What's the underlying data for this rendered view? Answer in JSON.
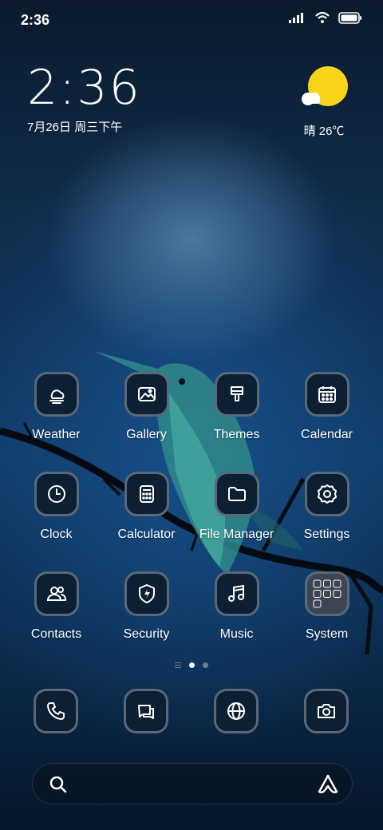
{
  "status_bar": {
    "time": "2:36"
  },
  "clock_widget": {
    "time": "2:36",
    "date": "7月26日 周三下午"
  },
  "weather_widget": {
    "text": "晴 26℃"
  },
  "apps": [
    {
      "label": "Weather",
      "icon": "weather-icon"
    },
    {
      "label": "Gallery",
      "icon": "gallery-icon"
    },
    {
      "label": "Themes",
      "icon": "themes-icon"
    },
    {
      "label": "Calendar",
      "icon": "calendar-icon"
    },
    {
      "label": "Clock",
      "icon": "clock-icon"
    },
    {
      "label": "Calculator",
      "icon": "calculator-icon"
    },
    {
      "label": "File Manager",
      "icon": "folder-icon"
    },
    {
      "label": "Settings",
      "icon": "gear-icon"
    },
    {
      "label": "Contacts",
      "icon": "contacts-icon"
    },
    {
      "label": "Security",
      "icon": "shield-icon"
    },
    {
      "label": "Music",
      "icon": "music-icon"
    },
    {
      "label": "System",
      "icon": "folder-grid-icon"
    }
  ],
  "page_indicator": {
    "pages": 2,
    "active": 0
  },
  "dock": [
    "phone-icon",
    "messages-icon",
    "browser-icon",
    "camera-icon"
  ],
  "search_bar": {
    "left_icon": "search-icon",
    "right_icon": "assistant-icon"
  },
  "colors": {
    "icon_bg": "#0d1f33",
    "icon_border": "#5a6878",
    "weather_sun": "#f7d417"
  }
}
